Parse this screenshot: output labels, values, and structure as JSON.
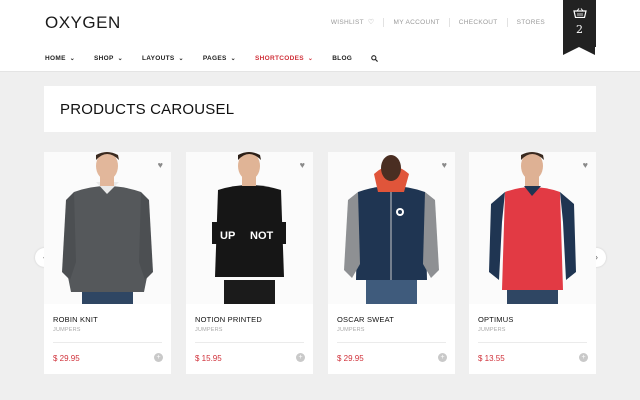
{
  "header": {
    "logo": "OXYGEN",
    "links": [
      {
        "label": "WISHLIST",
        "icon": "heart-icon"
      },
      {
        "label": "MY ACCOUNT"
      },
      {
        "label": "CHECKOUT"
      },
      {
        "label": "STORES"
      }
    ],
    "cart": {
      "count": "2",
      "icon": "basket-icon"
    }
  },
  "nav": {
    "items": [
      {
        "label": "HOME",
        "dropdown": true
      },
      {
        "label": "SHOP",
        "dropdown": true
      },
      {
        "label": "LAYOUTS",
        "dropdown": true
      },
      {
        "label": "PAGES",
        "dropdown": true
      },
      {
        "label": "SHORTCODES",
        "dropdown": true,
        "active": true
      },
      {
        "label": "BLOG",
        "dropdown": false
      }
    ],
    "search_icon": "search-icon"
  },
  "page": {
    "title": "PRODUCTS CAROUSEL"
  },
  "products": [
    {
      "name": "ROBIN KNIT",
      "category": "JUMPERS",
      "price": "$ 29.95",
      "colors": {
        "top": "#55585b",
        "bottom": "#2f4663",
        "skin": "#e2b79b"
      }
    },
    {
      "name": "NOTION PRINTED",
      "category": "JUMPERS",
      "price": "$ 15.95",
      "colors": {
        "top": "#161616",
        "bottom": "#1b1b1b",
        "skin": "#e0b496"
      }
    },
    {
      "name": "OSCAR SWEAT",
      "category": "JUMPERS",
      "price": "$ 29.95",
      "colors": {
        "top": "#1f3552",
        "bottom": "#3f5b7c",
        "skin": "#4a2e22"
      }
    },
    {
      "name": "OPTIMUS",
      "category": "JUMPERS",
      "price": "$ 13.55",
      "colors": {
        "top": "#e23a44",
        "bottom": "#2f4663",
        "skin": "#deb194"
      }
    }
  ],
  "accent_color": "#d0313a"
}
